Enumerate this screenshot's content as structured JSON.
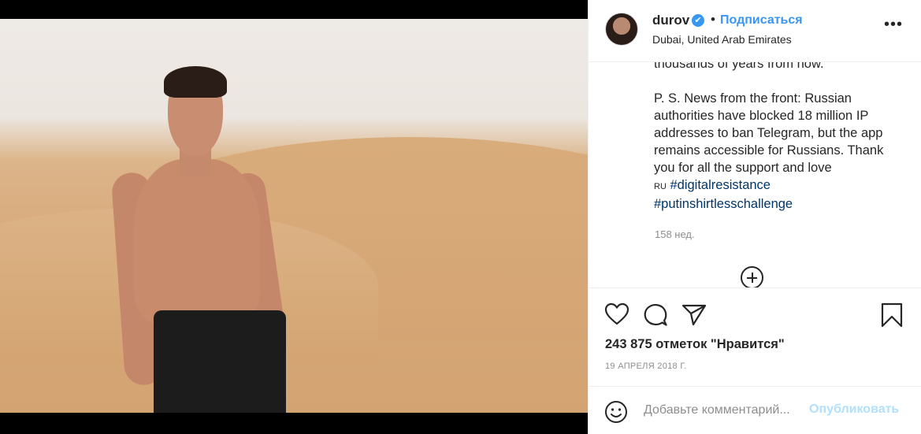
{
  "post": {
    "username": "durov",
    "verified_mark": "✔",
    "separator": "•",
    "follow_label": "Подписаться",
    "location": "Dubai, United Arab Emirates",
    "more_label": "•••",
    "caption_partial": "thousands of years from now.",
    "caption_ps": "P. S. News from the front: Russian authorities have blocked 18 million IP addresses to ban Telegram, but the app remains accessible for Russians. Thank you for all the support and love",
    "caption_flag": "RU",
    "hashtags": [
      "#digitalresistance",
      "#putinshirtlesschallenge"
    ],
    "time_ago": "158 нед.",
    "likes": "243 875 отметок \"Нравится\"",
    "date": "19 АПРЕЛЯ 2018 Г."
  },
  "comment": {
    "placeholder": "Добавьте комментарий...",
    "publish_label": "Опубликовать"
  },
  "icons": {
    "like": "heart-icon",
    "comment": "comment-bubble-icon",
    "share": "paper-plane-icon",
    "save": "bookmark-icon",
    "emoji": "smiley-icon",
    "load_more": "plus-circle-icon"
  },
  "colors": {
    "accent": "#3897f0",
    "hashtag": "#003569",
    "muted": "#8e8e8e",
    "publish_disabled": "#b2dffc"
  }
}
